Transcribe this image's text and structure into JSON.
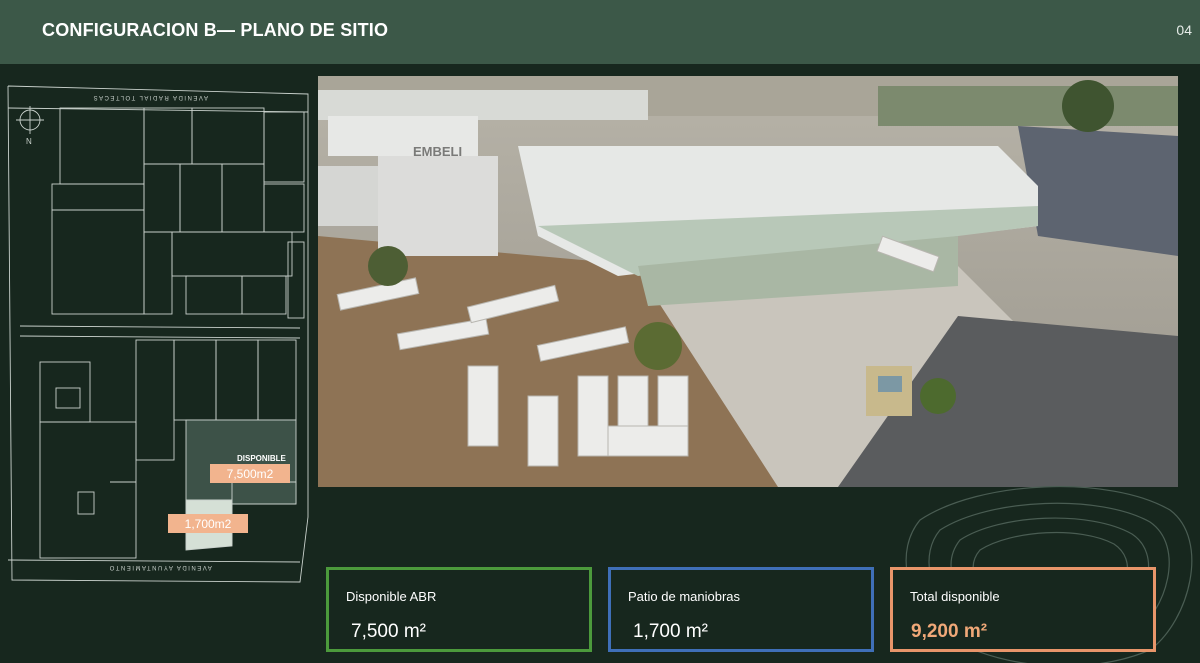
{
  "header": {
    "title": "CONFIGURACION B— PLANO DE SITIO",
    "page_number": "04"
  },
  "site_plan": {
    "street_top": "AVENIDA RADIAL TOLTECAS",
    "street_bottom": "AVENIDA AYUNTAMIENTO",
    "north_label": "N",
    "available_label": "DISPONIBLE",
    "area_building": "7,500m2",
    "area_yard": "1,700m2",
    "highlight_color": "#f2b48e"
  },
  "photo": {
    "sign_text": "EMBELI"
  },
  "cards": [
    {
      "label": "Disponible ABR",
      "value": "7,500 m²",
      "border_color": "#4c9a3c"
    },
    {
      "label": "Patio de maniobras",
      "value": "1,700 m²",
      "border_color": "#3f6fb8"
    },
    {
      "label": "Total disponible",
      "value": "9,200 m²",
      "border_color": "#e8956a"
    }
  ]
}
